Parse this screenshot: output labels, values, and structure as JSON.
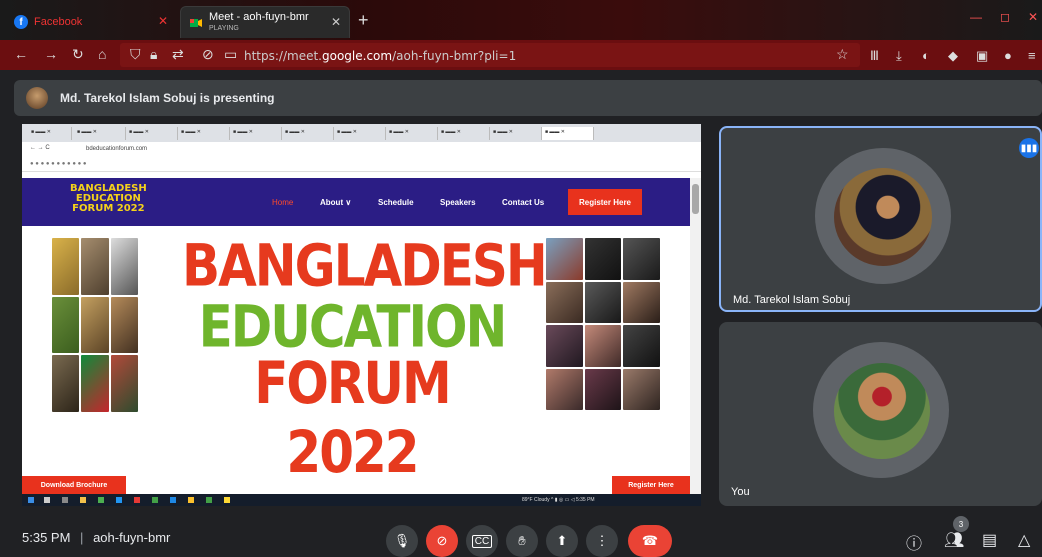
{
  "browser": {
    "tabs": [
      {
        "label": "Facebook",
        "active": false
      },
      {
        "label": "Meet - aoh-fuyn-bmr",
        "sublabel": "PLAYING",
        "active": true
      }
    ],
    "url_prefix": "https://meet.",
    "url_domain": "google.com",
    "url_path": "/aoh-fuyn-bmr?pli=1"
  },
  "presenting": {
    "text": "Md. Tarekol Islam Sobuj is presenting"
  },
  "shared_screen": {
    "address": "bdeducationforum.com",
    "logo_lines": [
      "BANGLADESH",
      "EDUCATION",
      "FORUM 2022"
    ],
    "nav": {
      "home": "Home",
      "about": "About ∨",
      "schedule": "Schedule",
      "speakers": "Speakers",
      "contact": "Contact Us",
      "register": "Register Here"
    },
    "hero": {
      "line1": "BANGLADESH",
      "line2": "EDUCATION",
      "line3": "FORUM 2022"
    },
    "download_button": "Download Brochure",
    "register_button": "Register Here",
    "taskbar_weather": "89°F Cloudy",
    "taskbar_time": "5:35 PM"
  },
  "participants": [
    {
      "name": "Md. Tarekol Islam Sobuj",
      "speaking": true
    },
    {
      "name": "You",
      "speaking": false
    }
  ],
  "controls": {
    "time": "5:35 PM",
    "separator": "|",
    "meeting_code": "aoh-fuyn-bmr",
    "people_count": "3"
  },
  "colors": {
    "meet_bg": "#202124",
    "tile_bg": "#3c4043",
    "end_call": "#ea4335",
    "active_speaker_border": "#8ab4f8",
    "site_nav": "#2b1d85",
    "hero_red": "#e63a1e",
    "hero_green": "#6fb52c"
  }
}
